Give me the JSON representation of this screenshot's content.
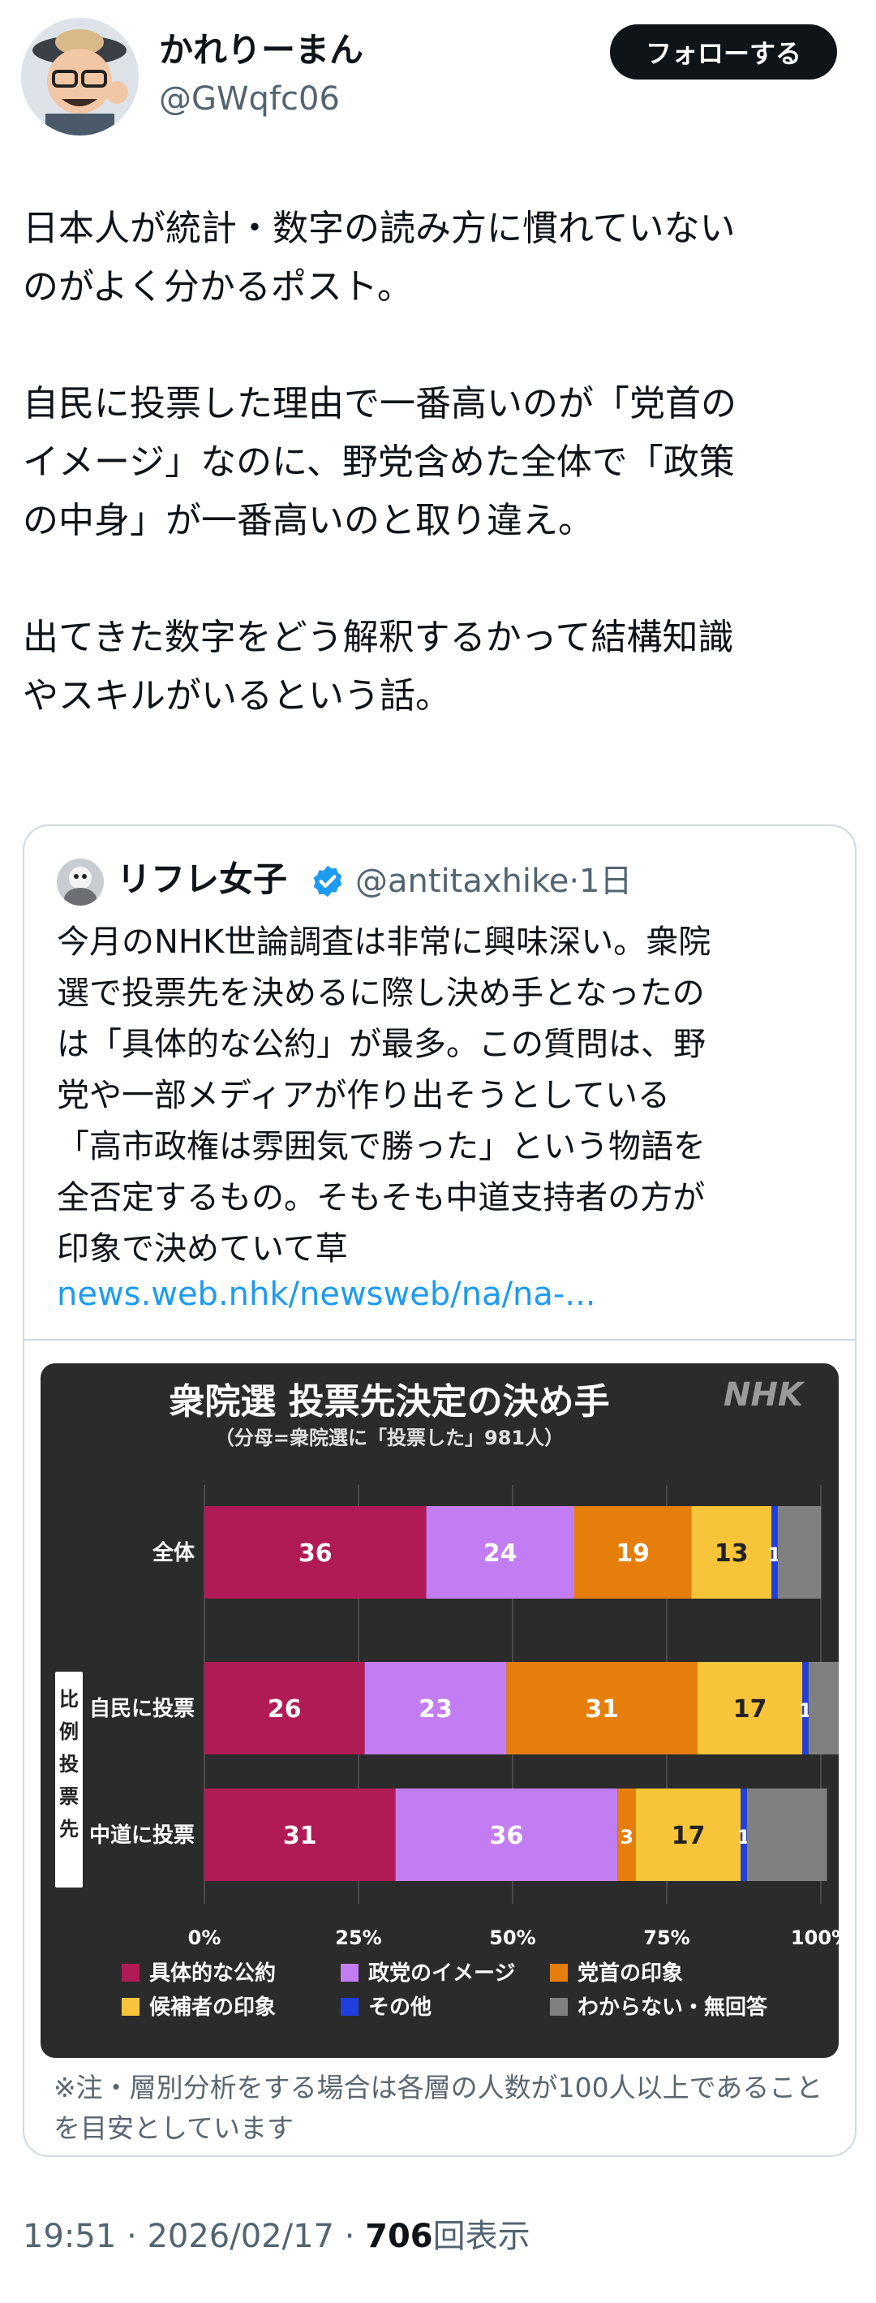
{
  "author": {
    "name": "かれりーまん",
    "handle": "@GWqfc06"
  },
  "follow_label": "フォローする",
  "post": {
    "paragraphs": [
      "日本人が統計・数字の読み方に慣れていない",
      "のがよく分かるポスト。",
      "",
      "自民に投票した理由で一番高いのが「党首の",
      "イメージ」なのに、野党含めた全体で「政策",
      "の中身」が一番高いのと取り違え。",
      "",
      "出てきた数字をどう解釈するかって結構知識",
      "やスキルがいるという話。"
    ]
  },
  "quote": {
    "name": "リフレ女子",
    "handle": "@antitaxhike",
    "time": "·1日",
    "lines": [
      "今月のNHK世論調査は非常に興味深い。衆院",
      "選で投票先を決めるに際し決め手となったの",
      "は「具体的な公約」が最多。この質問は、野",
      "党や一部メディアが作り出そうとしている",
      "「高市政権は雰囲気で勝った」という物語を",
      "全否定するもの。そもそも中道支持者の方が",
      "印象で決めていて草"
    ],
    "link": "news.web.nhk/newsweb/na/na-..."
  },
  "colors": {
    "series": [
      "#b01b55",
      "#c27df2",
      "#e67e0c",
      "#f8c53a",
      "#1f3fe0",
      "#808080"
    ],
    "chart_bg": "#2b2b2b",
    "verified": "#1d9bf0"
  },
  "chart_data": {
    "type": "bar",
    "orientation": "horizontal-stacked-100%",
    "title": "衆院選 投票先決定の決め手",
    "subtitle": "（分母=衆院選に「投票した」981人）",
    "brand": "NHK",
    "group_label": "比例投票先",
    "categories": [
      "全体",
      "自民に投票",
      "中道に投票"
    ],
    "series": [
      {
        "name": "具体的な公約",
        "values": [
          36,
          26,
          31
        ]
      },
      {
        "name": "政党のイメージ",
        "values": [
          24,
          23,
          36
        ]
      },
      {
        "name": "党首の印象",
        "values": [
          19,
          31,
          3
        ]
      },
      {
        "name": "候補者の印象",
        "values": [
          13,
          17,
          17
        ]
      },
      {
        "name": "その他",
        "values": [
          1,
          1,
          1
        ]
      },
      {
        "name": "わからない・無回答",
        "values": [
          7,
          5,
          13
        ]
      }
    ],
    "x_ticks": [
      "0%",
      "25%",
      "50%",
      "75%",
      "100%"
    ],
    "xlim": [
      0,
      100
    ],
    "legend": "bottom"
  },
  "note": "※注・層別分析をする場合は各層の人数が100人以上であることを目安としています",
  "footer": {
    "time": "19:51",
    "sep": " · ",
    "date": "2026/02/17",
    "sep2": " · ",
    "views": "706",
    "views_label": "回表示"
  }
}
